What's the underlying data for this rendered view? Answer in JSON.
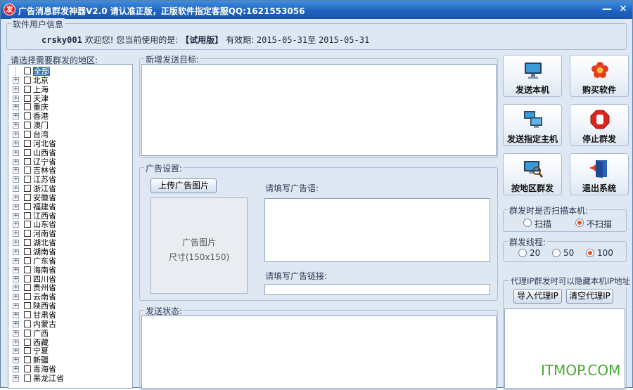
{
  "window": {
    "title": "广告消息群发神器V2.0 请认准正版，正版软件指定客服QQ:1621553056",
    "app_icon": "发",
    "minimize": "—",
    "close": "✕"
  },
  "user_info": {
    "group_title": "软件用户信息",
    "username": "crsky001",
    "welcome": "欢迎您! 您当前使用的是:",
    "version": "【试用版】",
    "valid_label": "有效期:",
    "valid_from": "2015-05-31",
    "valid_to_sep": "至",
    "valid_to": "2015-05-31"
  },
  "regions": {
    "label": "请选择需要群发的地区:",
    "items": [
      "全部",
      "北京",
      "上海",
      "天津",
      "重庆",
      "香港",
      "澳门",
      "台湾",
      "河北省",
      "山西省",
      "辽宁省",
      "吉林省",
      "江苏省",
      "浙江省",
      "安徽省",
      "福建省",
      "江西省",
      "山东省",
      "河南省",
      "湖北省",
      "湖南省",
      "广东省",
      "海南省",
      "四川省",
      "贵州省",
      "云南省",
      "陕西省",
      "甘肃省",
      "内蒙古",
      "广西",
      "西藏",
      "宁夏",
      "新疆",
      "青海省",
      "黑龙江省"
    ]
  },
  "targets": {
    "label": "新增发送目标:"
  },
  "ad_settings": {
    "group_title": "广告设置:",
    "upload_button": "上传广告图片",
    "image_placeholder_line1": "广告图片",
    "image_placeholder_line2": "尺寸(150x150)",
    "ad_text_label": "请填写广告语:",
    "ad_link_label": "请填写广告链接:"
  },
  "status": {
    "label": "发送状态:"
  },
  "actions": {
    "send_local": "发送本机",
    "buy": "购买软件",
    "send_host": "发送指定主机",
    "stop": "停止群发",
    "by_region": "按地区群发",
    "exit": "退出系统"
  },
  "scan": {
    "group_title": "群发时是否扫描本机:",
    "options": [
      "扫描",
      "不扫描"
    ],
    "selected": "不扫描"
  },
  "threads": {
    "group_title": "群发线程:",
    "options": [
      "20",
      "50",
      "100"
    ],
    "selected": "100"
  },
  "proxy": {
    "group_title": "代理IP群发时可以隐藏本机IP地址",
    "import_button": "导入代理IP",
    "clear_button": "清空代理IP"
  },
  "watermark": "ITMOP.COM"
}
